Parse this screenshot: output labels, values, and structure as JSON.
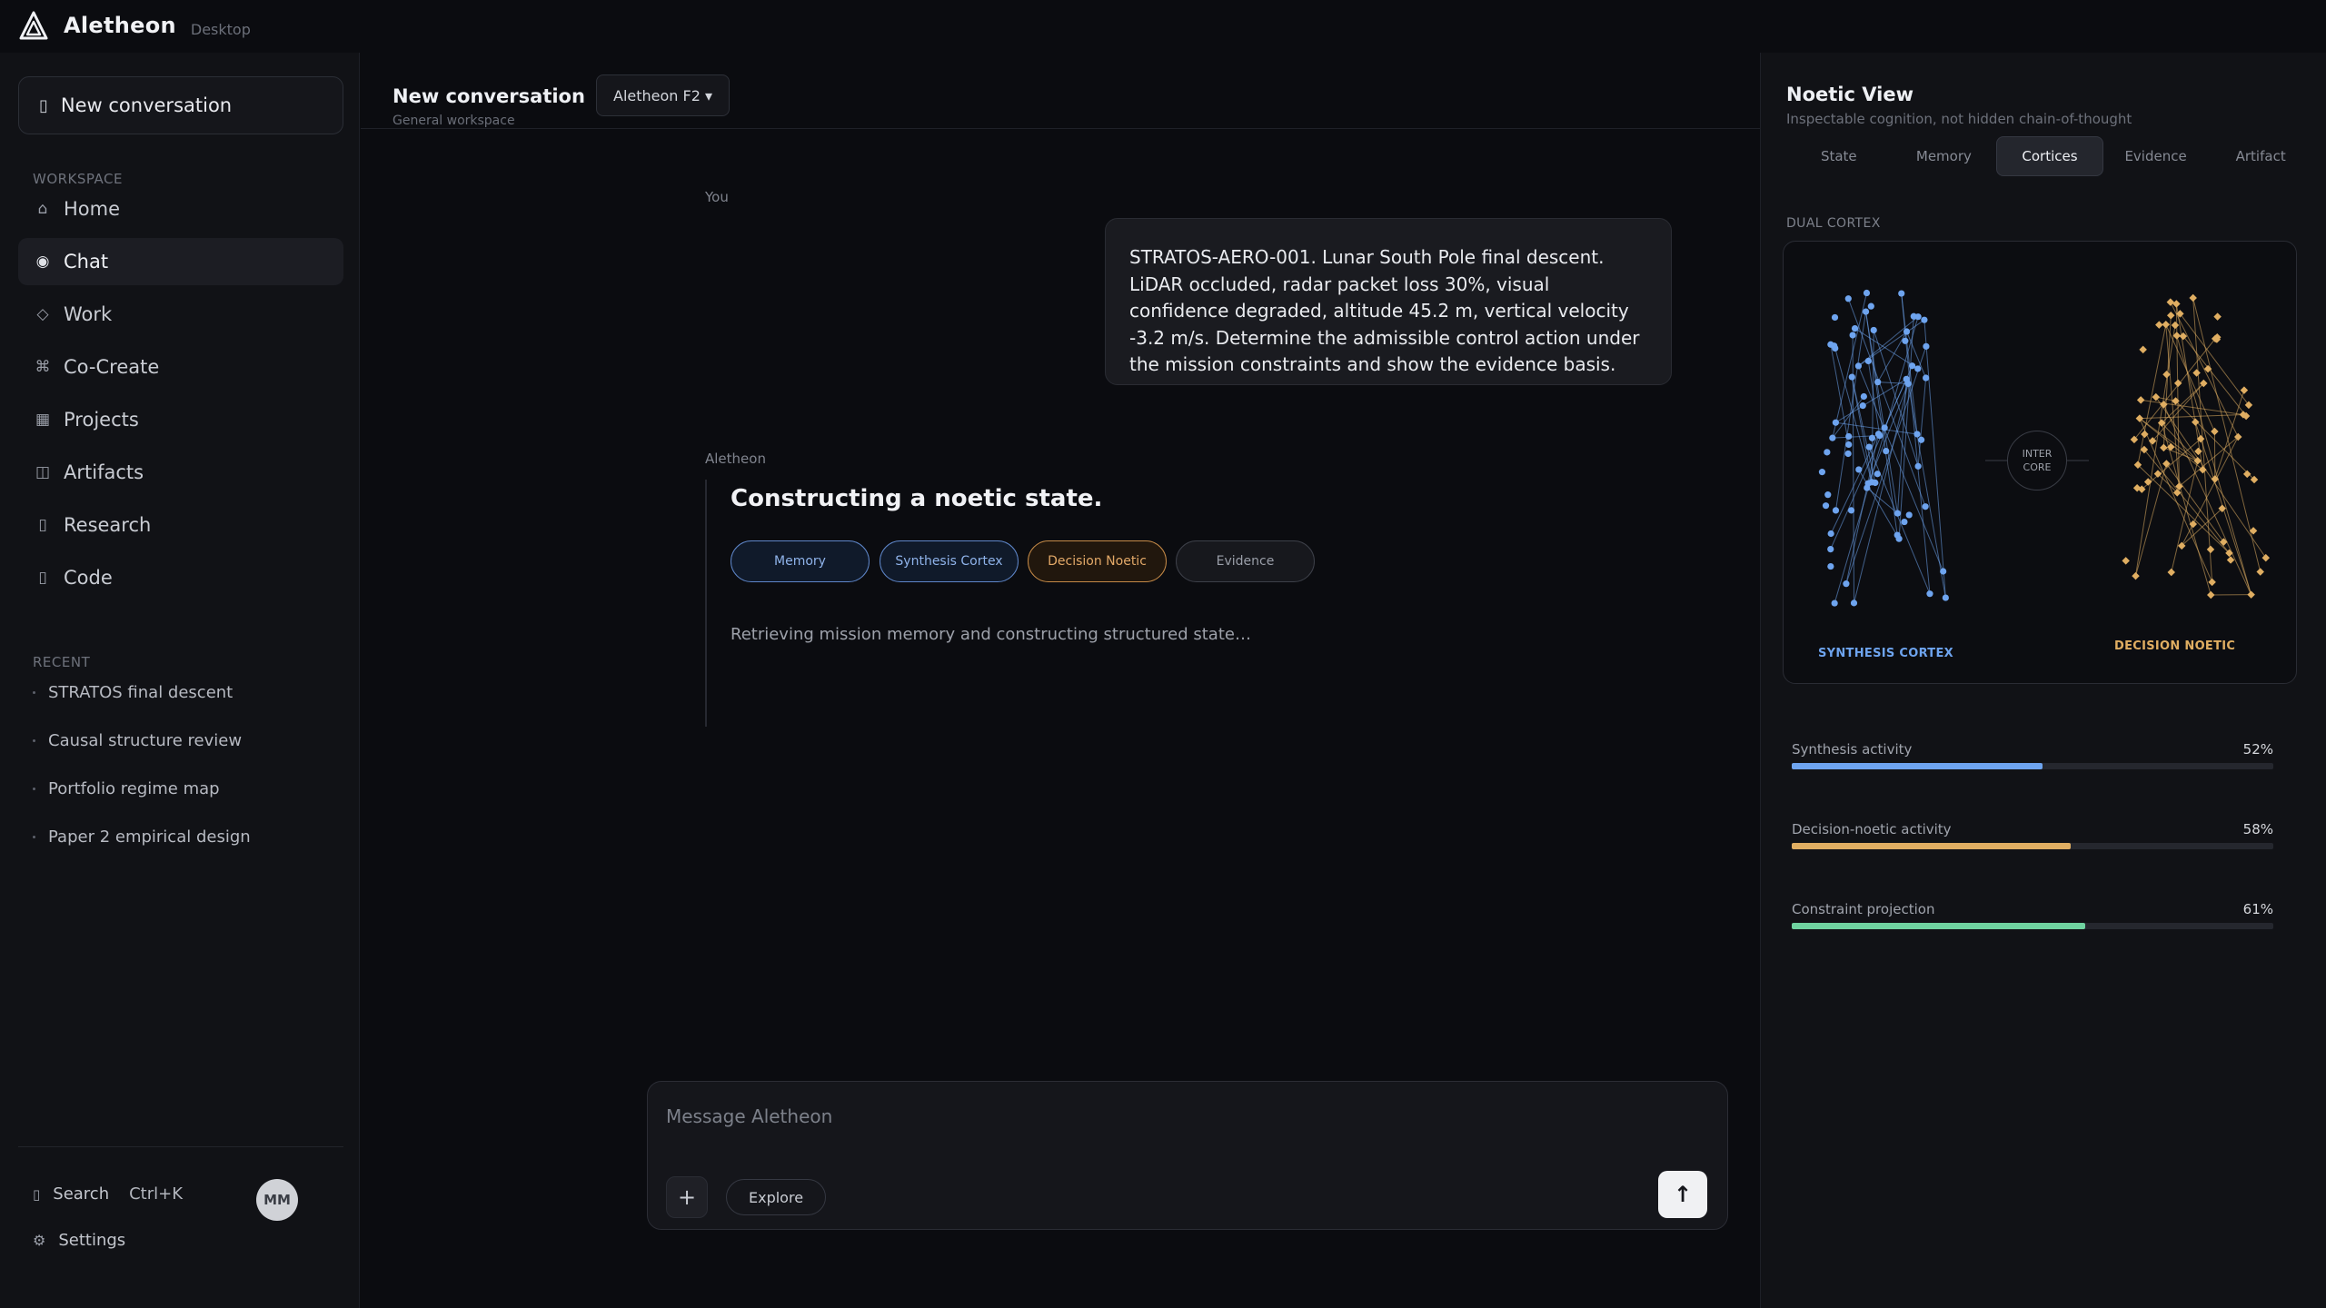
{
  "brand": {
    "name": "Aletheon",
    "sub": "Desktop"
  },
  "sidebar": {
    "new_conversation": "New conversation",
    "workspace_label": "WORKSPACE",
    "items": [
      {
        "label": "Home",
        "icon": "home-icon"
      },
      {
        "label": "Chat",
        "icon": "chat-icon"
      },
      {
        "label": "Work",
        "icon": "diamond-icon"
      },
      {
        "label": "Co-Create",
        "icon": "command-icon"
      },
      {
        "label": "Projects",
        "icon": "grid-icon"
      },
      {
        "label": "Artifacts",
        "icon": "artifacts-icon"
      },
      {
        "label": "Research",
        "icon": "research-icon"
      },
      {
        "label": "Code",
        "icon": "code-icon"
      }
    ],
    "recent_label": "RECENT",
    "recent": [
      "STRATOS final descent",
      "Causal structure review",
      "Portfolio regime map",
      "Paper 2 empirical design"
    ],
    "search_label": "Search",
    "search_shortcut": "Ctrl+K",
    "settings_label": "Settings",
    "avatar_initials": "MM"
  },
  "conversation": {
    "title": "New conversation",
    "subtitle": "General workspace",
    "model": "Aletheon F2 ▾",
    "user_role": "You",
    "user_message": "STRATOS-AERO-001. Lunar South Pole final descent. LiDAR occluded, radar packet loss 30%, visual confidence degraded, altitude 45.2 m, vertical velocity -3.2 m/s. Determine the admissible control action under the mission constraints and show the evidence basis.",
    "assistant_role": "Aletheon",
    "response_title": "Constructing a noetic state.",
    "chips": [
      "Memory",
      "Synthesis Cortex",
      "Decision Noetic",
      "Evidence"
    ],
    "status": "Retrieving mission memory and constructing structured state…"
  },
  "composer": {
    "placeholder": "Message Aletheon",
    "plus": "+",
    "explore": "Explore",
    "send": "↑"
  },
  "panel": {
    "title": "Noetic View",
    "subtitle": "Inspectable cognition, not hidden chain-of-thought",
    "tabs": [
      "State",
      "Memory",
      "Cortices",
      "Evidence",
      "Artifact"
    ],
    "active_tab": "Cortices",
    "section": "DUAL CORTEX",
    "synthesis_label": "SYNTHESIS CORTEX",
    "decision_label": "DECISION NOETIC",
    "inter_core": "INTER CORE",
    "metrics": [
      {
        "label": "Synthesis activity",
        "value": "52%",
        "fraction": 0.52,
        "color": "#6ea4ef"
      },
      {
        "label": "Decision-noetic activity",
        "value": "58%",
        "fraction": 0.58,
        "color": "#e0ae62"
      },
      {
        "label": "Constraint projection",
        "value": "61%",
        "fraction": 0.61,
        "color": "#6fd3a0"
      }
    ]
  },
  "colors": {
    "synthesis": "#6ea4ef",
    "decision": "#e0ae62",
    "accent": "#eef0f4"
  }
}
